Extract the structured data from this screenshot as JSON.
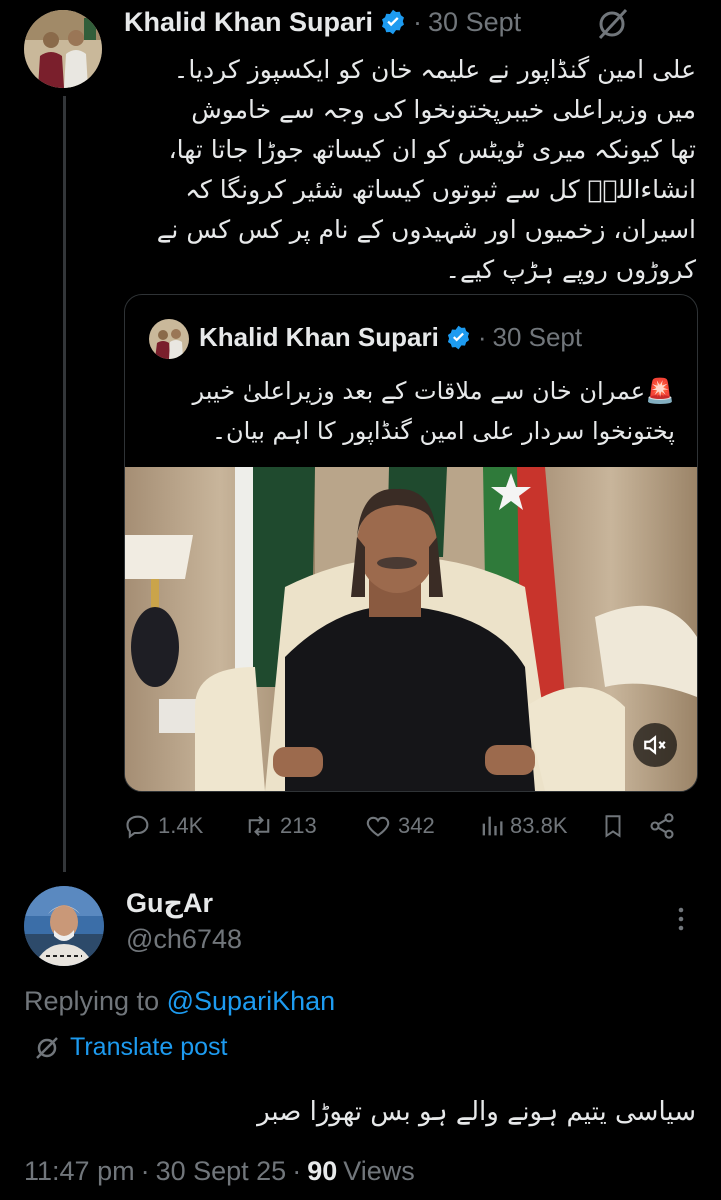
{
  "main_post": {
    "author": "Khalid Khan Supari",
    "separator": "·",
    "date": "30 Sept",
    "text_lines": [
      "علی امین گنڈاپور نے علیمہ خان کو ایکسپوز کردیا۔",
      "میں وزیراعلی خیبرپختونخوا کی وجہ سے خاموش",
      "تھا کیونکہ میری ٹویٹس کو ان کیساتھ جوڑا جاتا تھا،",
      "انشاءاللہؑ کل سے ثبوتوں کیساتھ شئیر کرونگا کہ",
      "اسیران، زخمیوں اور شہیدوں کے نام پر کس کس نے",
      "کروڑوں روپے ہڑپ کیے۔"
    ],
    "quoted": {
      "author": "Khalid Khan Supari",
      "separator": "·",
      "date": "30 Sept",
      "text_lines": [
        "🚨عمران خان سے ملاقات کے بعد وزیراعلیٰ خیبر",
        "پختونخوا سردار علی امین گنڈاپور کا اہم بیان۔"
      ]
    },
    "stats": {
      "replies": "1.4K",
      "reposts": "213",
      "likes": "342",
      "views": "83.8K"
    }
  },
  "reply": {
    "display_name": "GuجAr",
    "handle": "@ch6748",
    "replying_prefix": "Replying to",
    "replying_to": "@SupariKhan",
    "translate_label": "Translate post",
    "text": "سیاسی یتیم ہونے والے ہو بس تھوڑا صبر",
    "time": "11:47 pm",
    "dot": "·",
    "date": "30 Sept 25",
    "views_count": "90",
    "views_label": "Views"
  },
  "colors": {
    "background": "#000000",
    "text": "#e7e9ea",
    "muted": "#71767b",
    "accent": "#1d9bf0",
    "border": "#2f3336"
  },
  "icons": [
    "verified-badge-icon",
    "grok-icon",
    "reply-icon",
    "repost-icon",
    "like-icon",
    "views-icon",
    "bookmark-icon",
    "share-icon",
    "more-icon",
    "translate-icon",
    "mute-icon"
  ]
}
